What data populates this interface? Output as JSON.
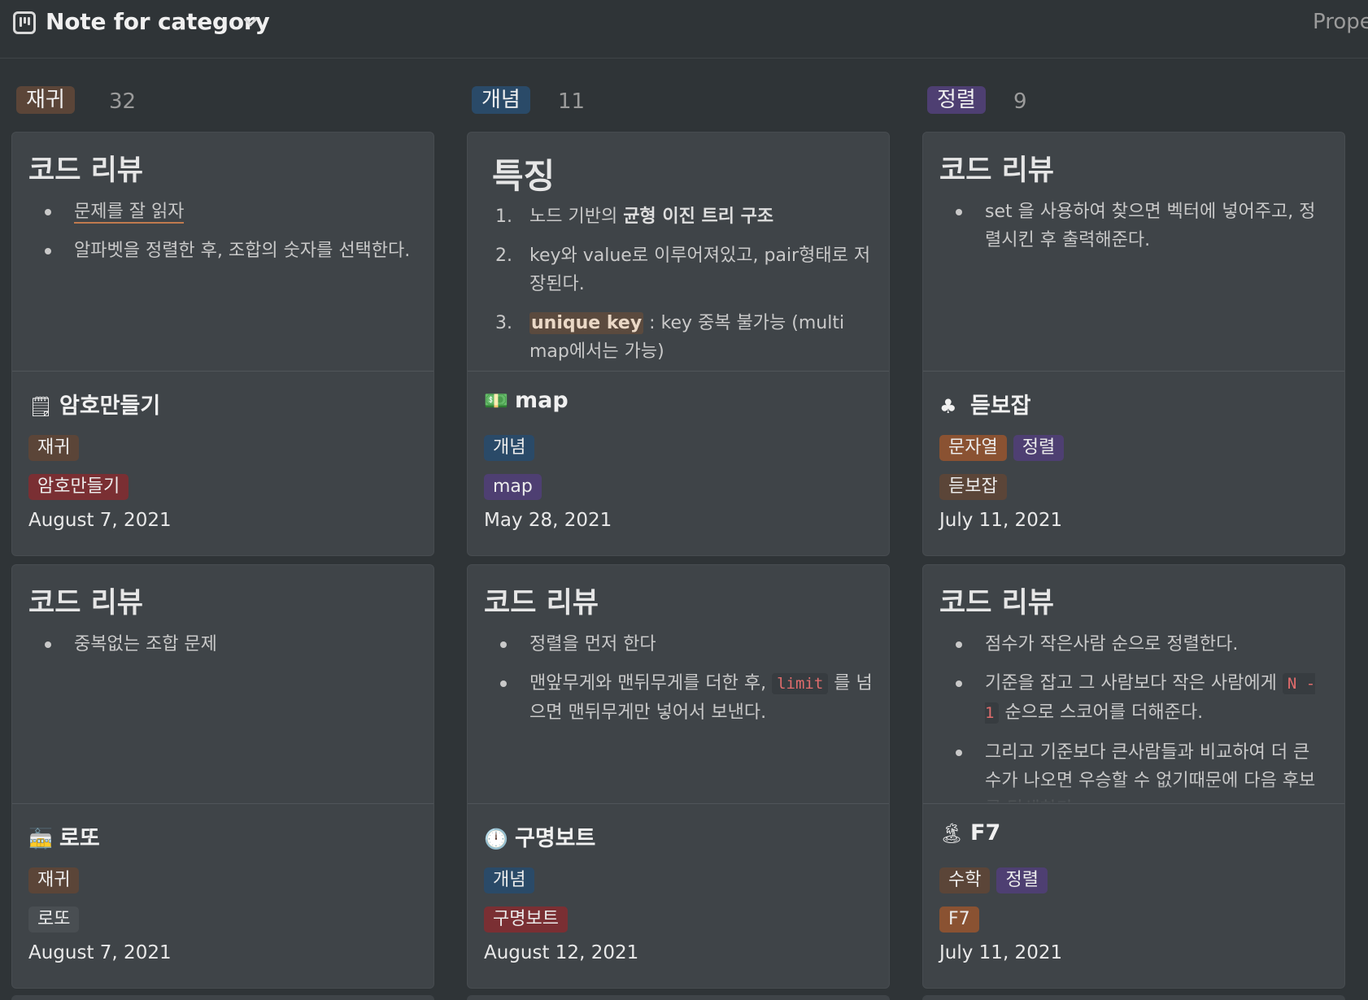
{
  "header": {
    "title": "Note for category",
    "properties_label": "Prope"
  },
  "columns": [
    {
      "tag": "재귀",
      "count": "32",
      "cards": [
        {
          "preview_title": "코드 리뷰",
          "preview_items": [
            "문제를 잘 읽자",
            "알파벳을 정렬한 후, 조합의 숫자를 선택한다."
          ],
          "page_title": "암호만들기",
          "tags_row1": [
            "재귀"
          ],
          "tags_row2": [
            "암호만들기"
          ],
          "date": "August 7, 2021"
        },
        {
          "preview_title": "코드 리뷰",
          "preview_items": [
            "중복없는 조합 문제"
          ],
          "page_title": "로또",
          "tags_row1": [
            "재귀"
          ],
          "tags_row2": [
            "로또"
          ],
          "date": "August 7, 2021"
        }
      ]
    },
    {
      "tag": "개념",
      "count": "11",
      "cards": [
        {
          "preview_title": "특징",
          "preview_items": [
            {
              "a": "노드 기반의 ",
              "b": "균형 이진 트리 구조"
            },
            "key와 value로 이루어져있고, pair형태로 저장된다.",
            {
              "hl": "unique key",
              "rest": " : key 중복 불가능 (multi map에서는 가능)"
            }
          ],
          "page_title": "map",
          "tags_row1": [
            "개념"
          ],
          "tags_row2": [
            "map"
          ],
          "date": "May 28, 2021"
        },
        {
          "preview_title": "코드 리뷰",
          "preview_items": [
            "정렬을 먼저 한다",
            {
              "a": "맨앞무게와 맨뒤무게를 더한 후, ",
              "code": "limit",
              "b": " 를 넘으면 맨뒤무게만 넣어서 보낸다."
            }
          ],
          "page_title": "구명보트",
          "tags_row1": [
            "개념"
          ],
          "tags_row2": [
            "구명보트"
          ],
          "date": "August 12, 2021"
        }
      ]
    },
    {
      "tag": "정렬",
      "count": "9",
      "cards": [
        {
          "preview_title": "코드 리뷰",
          "preview_items": [
            "set 을 사용하여 찾으면 벡터에 넣어주고, 정렬시킨 후 출력해준다."
          ],
          "page_title": "듣보잡",
          "tags_row1": [
            "문자열",
            "정렬"
          ],
          "tags_row2": [
            "듣보잡"
          ],
          "date": "July 11, 2021"
        },
        {
          "preview_title": "코드 리뷰",
          "preview_items": [
            "점수가 작은사람 순으로 정렬한다.",
            {
              "a": "기준을 잡고 그 사람보다 작은 사람에게 ",
              "code": "N - 1",
              "b": " 순으로 스코어를 더해준다."
            },
            "그리고 기준보다 큰사람들과 비교하여 더 큰 수가 나오면 우승할 수 없기때문에 다음 후보를 탐색한다."
          ],
          "page_title": "F7",
          "tags_row1": [
            "수학",
            "정렬"
          ],
          "tags_row2": [
            "F7"
          ],
          "date": "July 11, 2021"
        }
      ]
    }
  ],
  "icons": {
    "board": "board-view-icon",
    "chevron": "chevron-down-icon",
    "card_emojis": [
      "notepad-icon",
      "dollar-bill-icon",
      "club-suit-icon",
      "tram-icon",
      "clock-icon",
      "island-icon"
    ]
  },
  "emoji_glyphs": [
    "🗒",
    "💵",
    "♣",
    "🚋",
    "🕛",
    "🏝"
  ],
  "colors": {
    "background": "#2f3437",
    "card": "#3f4448",
    "tag_brown": "#5b4538",
    "tag_blue": "#2a4a68",
    "tag_purple": "#4e3f72",
    "tag_red": "#7a2f33",
    "tag_orange": "#8a5232",
    "tag_gray": "#494e52"
  }
}
